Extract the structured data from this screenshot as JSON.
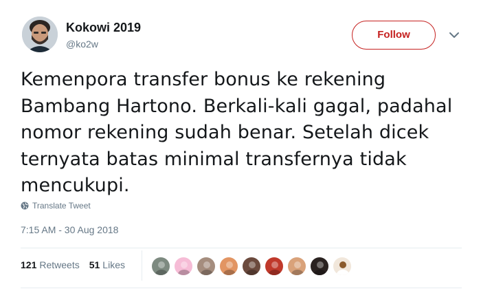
{
  "user": {
    "display_name": "Kokowi 2019",
    "handle": "@ko2w",
    "avatar_icon": "profile-photo"
  },
  "follow_button": {
    "label": "Follow",
    "color": "#c5201f"
  },
  "tweet": {
    "lines": [
      "Kemenpora transfer bonus ke rekening",
      "Bambang Hartono. Berkali-kali gagal, padahal",
      "nomor rekening sudah benar. Setelah dicek",
      "ternyata batas minimal transfernya tidak",
      "mencukupi."
    ],
    "translate_label": "Translate Tweet",
    "timestamp": "7:15 AM - 30 Aug 2018"
  },
  "stats": {
    "retweets_count": "121",
    "retweets_label": "Retweets",
    "likes_count": "51",
    "likes_label": "Likes"
  },
  "likers": [
    {
      "icon": "liker-avatar-gray",
      "color": "#7d8a80"
    },
    {
      "icon": "liker-avatar-pink",
      "color": "#f6bcd6"
    },
    {
      "icon": "liker-avatar-group",
      "color": "#a58d7e"
    },
    {
      "icon": "liker-avatar-orange",
      "color": "#e29563"
    },
    {
      "icon": "liker-avatar-dark",
      "color": "#6b4a3d"
    },
    {
      "icon": "liker-avatar-red",
      "color": "#c0392b"
    },
    {
      "icon": "liker-avatar-girl",
      "color": "#d9a27a"
    },
    {
      "icon": "liker-avatar-black",
      "color": "#2a2220"
    },
    {
      "icon": "liker-avatar-coffee",
      "color": "#f1e7db"
    }
  ]
}
